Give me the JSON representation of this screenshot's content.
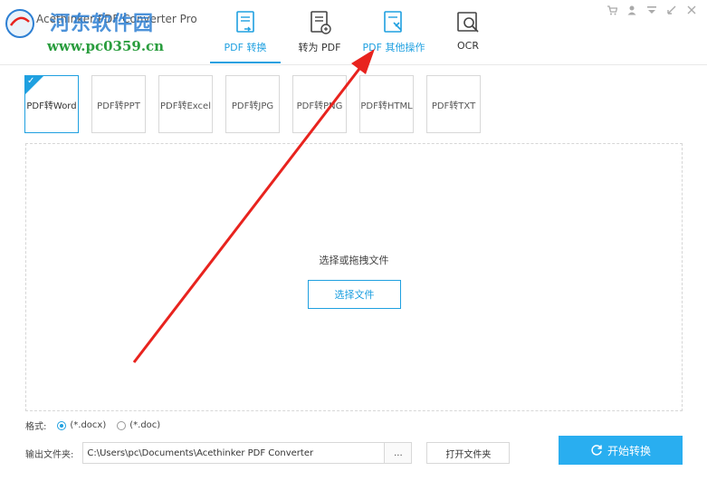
{
  "header": {
    "app_title": "Acethinker PDF Converter Pro",
    "watermark_text": "河东软件园",
    "watermark_url": "www.pc0359.cn",
    "tabs": [
      {
        "label": "PDF 转换",
        "icon": "pdf-convert-icon",
        "active": true
      },
      {
        "label": "转为 PDF",
        "icon": "to-pdf-icon",
        "active": false
      },
      {
        "label": "PDF 其他操作",
        "icon": "pdf-tools-icon",
        "active": false
      },
      {
        "label": "OCR",
        "icon": "ocr-icon",
        "active": false
      }
    ],
    "window_controls": [
      "cart-icon",
      "user-icon",
      "menu-icon",
      "minimize-icon",
      "close-icon"
    ]
  },
  "cards": [
    {
      "label": "PDF转Word",
      "selected": true
    },
    {
      "label": "PDF转PPT",
      "selected": false
    },
    {
      "label": "PDF转Excel",
      "selected": false
    },
    {
      "label": "PDF转JPG",
      "selected": false
    },
    {
      "label": "PDF转PNG",
      "selected": false
    },
    {
      "label": "PDF转HTML",
      "selected": false
    },
    {
      "label": "PDF转TXT",
      "selected": false
    }
  ],
  "dropzone": {
    "hint": "选择或拖拽文件",
    "select_button": "选择文件"
  },
  "format": {
    "label": "格式:",
    "options": [
      "(*.docx)",
      "(*.doc)"
    ],
    "selected": "(*.docx)"
  },
  "output": {
    "label": "输出文件夹:",
    "path": "C:\\Users\\pc\\Documents\\Acethinker PDF Converter",
    "browse_label": "...",
    "open_folder_label": "打开文件夹"
  },
  "start_button": "开始转换",
  "colors": {
    "accent": "#1fa0e0",
    "start_button": "#29aef0",
    "annotation": "#e8231e"
  }
}
